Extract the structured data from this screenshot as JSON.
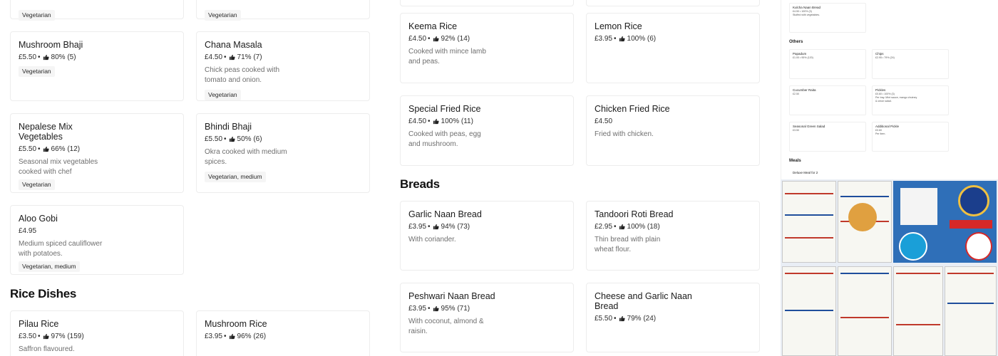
{
  "colors": {
    "accent": "#1b1b1b",
    "muted": "#6f6f6f",
    "border": "#ededed",
    "badge_bg": "#f5f5f5"
  },
  "sections": {
    "rice_dishes": "Rice Dishes",
    "breads": "Breads"
  },
  "items": {
    "veg_top_left": {
      "badge": "Vegetarian"
    },
    "veg_top_right": {
      "badge": "Vegetarian"
    },
    "mushroom_bhaji": {
      "name": "Mushroom Bhaji",
      "price": "£5.50",
      "rating": "80% (5)",
      "badge": "Vegetarian"
    },
    "chana_masala": {
      "name": "Chana Masala",
      "price": "£4.50",
      "rating": "71% (7)",
      "desc": "Chick peas cooked with tomato and onion.",
      "badge": "Vegetarian"
    },
    "nepalese_mix": {
      "name": "Nepalese Mix Vegetables",
      "price": "£5.50",
      "rating": "66% (12)",
      "desc": "Seasonal mix vegetables cooked with chef special...",
      "badge": "Vegetarian"
    },
    "bhindi_bhaji": {
      "name": "Bhindi Bhaji",
      "price": "£5.50",
      "rating": "50% (6)",
      "desc": "Okra cooked with medium spices.",
      "badge": "Vegetarian, medium"
    },
    "aloo_gobi": {
      "name": "Aloo Gobi",
      "price": "£4.95",
      "desc": "Medium spiced cauliflower with potatoes.",
      "badge": "Vegetarian, medium"
    },
    "pilau_rice": {
      "name": "Pilau Rice",
      "price": "£3.50",
      "rating": "97% (159)",
      "desc": "Saffron flavoured."
    },
    "mushroom_rice": {
      "name": "Mushroom Rice",
      "price": "£3.95",
      "rating": "96% (26)"
    },
    "keema_rice": {
      "name": "Keema Rice",
      "price": "£4.50",
      "rating": "92% (14)",
      "desc": "Cooked with mince lamb and peas."
    },
    "lemon_rice": {
      "name": "Lemon Rice",
      "price": "£3.95",
      "rating": "100% (6)"
    },
    "special_fried_rice": {
      "name": "Special Fried Rice",
      "price": "£4.50",
      "rating": "100% (11)",
      "desc": "Cooked with peas, egg and mushroom."
    },
    "chicken_fried_rice": {
      "name": "Chicken Fried Rice",
      "price": "£4.50",
      "desc": "Fried with chicken."
    },
    "garlic_naan": {
      "name": "Garlic Naan Bread",
      "price": "£3.95",
      "rating": "94% (73)",
      "desc": "With coriander."
    },
    "tandoori_roti": {
      "name": "Tandoori Roti Bread",
      "price": "£2.95",
      "rating": "100% (18)",
      "desc": "Thin bread with plain wheat flour."
    },
    "peshwari_naan": {
      "name": "Peshwari Naan Bread",
      "price": "£3.95",
      "rating": "95% (71)",
      "desc": "With coconut, almond & raisin."
    },
    "cheese_garlic_naan": {
      "name": "Cheese and Garlic Naan Bread",
      "price": "£5.50",
      "rating": "79% (24)"
    }
  },
  "preview": {
    "kulcha": {
      "name": "Kulcha Naan Bread",
      "meta": "£4.50 • 100% (3)",
      "desc": "Stuffed with vegetables."
    },
    "others_title": "Others",
    "papadum": {
      "name": "Papadum",
      "meta": "£1.00 • 95% (120)"
    },
    "chips": {
      "name": "Chips",
      "meta": "£2.95 • 79% (24)"
    },
    "cucumber_raita": {
      "name": "Cucumber Raita",
      "meta": "£2.50"
    },
    "pickles": {
      "name": "Pickles",
      "meta": "£0.60 • 100% (3)",
      "desc": "Per tray. Mint sauce, mango chutney & onion salad."
    },
    "green_salad": {
      "name": "Seasonal Green Salad",
      "meta": "£3.50"
    },
    "additional_pickle": {
      "name": "Additional Pickle",
      "meta": "£0.60",
      "desc": "Per item."
    },
    "meals_title": "Meals",
    "deluxe_meal": "Deluxe Meal for 2"
  }
}
